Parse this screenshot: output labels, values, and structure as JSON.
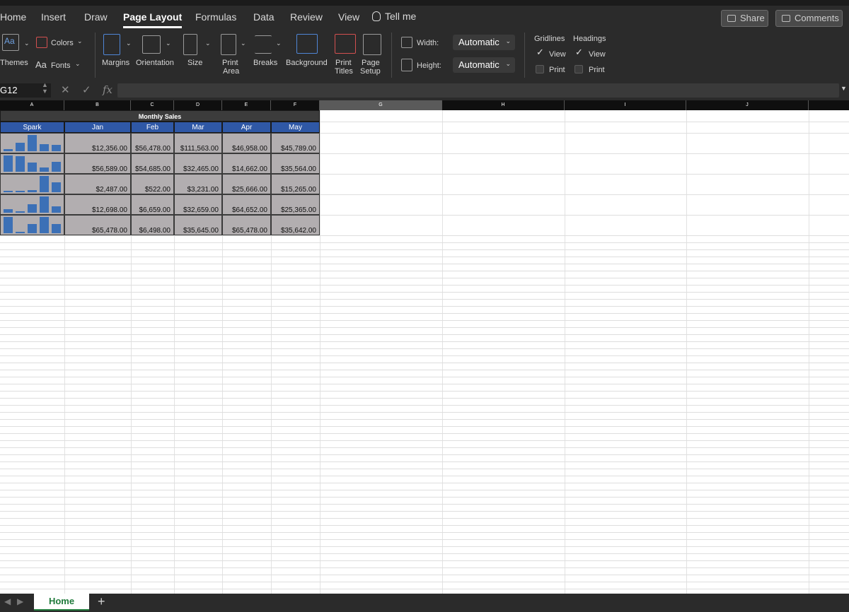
{
  "ribbon_tabs": [
    "Home",
    "Insert",
    "Draw",
    "Page Layout",
    "Formulas",
    "Data",
    "Review",
    "View"
  ],
  "active_tab": "Page Layout",
  "tell_me": "Tell me",
  "share_label": "Share",
  "comments_label": "Comments",
  "themes": {
    "themes_label": "Themes",
    "colors_label": "Colors",
    "fonts_label": "Fonts"
  },
  "page_setup": {
    "margins": "Margins",
    "orientation": "Orientation",
    "size": "Size",
    "print_area_1": "Print",
    "print_area_2": "Area",
    "breaks": "Breaks",
    "background": "Background",
    "print_titles_1": "Print",
    "print_titles_2": "Titles",
    "page_setup_1": "Page",
    "page_setup_2": "Setup"
  },
  "scale": {
    "width_label": "Width:",
    "width_value": "Automatic",
    "height_label": "Height:",
    "height_value": "Automatic"
  },
  "sheet_options": {
    "gridlines": "Gridlines",
    "headings": "Headings",
    "view": "View",
    "print": "Print"
  },
  "formula_bar": {
    "name_box": "G12",
    "fx": "fx",
    "value": ""
  },
  "columns": [
    "A",
    "B",
    "C",
    "D",
    "E",
    "F",
    "G",
    "H",
    "I",
    "J"
  ],
  "selected_column": "G",
  "table": {
    "title": "Monthly Sales",
    "headers": [
      "Spark",
      "Jan",
      "Feb",
      "Mar",
      "Apr",
      "May"
    ],
    "rows": [
      [
        "$12,356.00",
        "$56,478.00",
        "$111,563.00",
        "$46,958.00",
        "$45,789.00"
      ],
      [
        "$56,589.00",
        "$54,685.00",
        "$32,465.00",
        "$14,662.00",
        "$35,564.00"
      ],
      [
        "$2,487.00",
        "$522.00",
        "$3,231.00",
        "$25,666.00",
        "$15,265.00"
      ],
      [
        "$12,698.00",
        "$6,659.00",
        "$32,659.00",
        "$64,652.00",
        "$25,365.00"
      ],
      [
        "$65,478.00",
        "$6,498.00",
        "$35,645.00",
        "$65,478.00",
        "$35,642.00"
      ]
    ],
    "spark_values": [
      [
        12356,
        56478,
        111563,
        46958,
        45789
      ],
      [
        56589,
        54685,
        32465,
        14662,
        35564
      ],
      [
        2487,
        522,
        3231,
        25666,
        15265
      ],
      [
        12698,
        6659,
        32659,
        64652,
        25365
      ],
      [
        65478,
        6498,
        35645,
        65478,
        35642
      ]
    ]
  },
  "sheet_tab": "Home",
  "add_sheet": "+",
  "colors": {
    "ribbon_bg": "#2b2b2b",
    "header_blue": "#2f58a6",
    "cell_grey": "#b2aeb0",
    "spark_blue": "#3c70b6",
    "sheet_green": "#1f7a3b"
  }
}
